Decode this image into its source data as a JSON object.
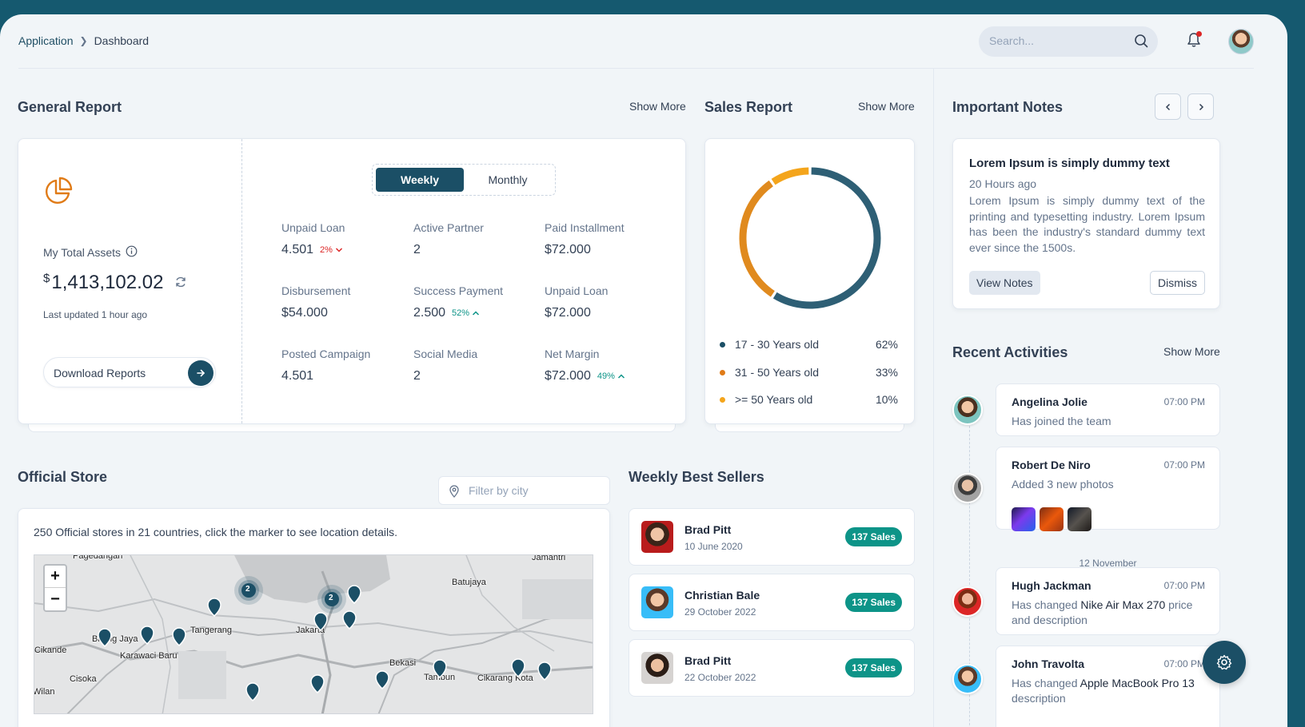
{
  "header": {
    "breadcrumb": [
      "Application",
      "Dashboard"
    ],
    "search_placeholder": "Search...",
    "icons": [
      "search-icon",
      "bell-icon",
      "avatar"
    ]
  },
  "general_report": {
    "title": "General Report",
    "show_more": "Show More",
    "assets_label": "My Total Assets",
    "currency": "$",
    "assets_value": "1,413,102.02",
    "updated": "Last updated 1 hour ago",
    "download_label": "Download Reports",
    "tabs": [
      "Weekly",
      "Monthly"
    ],
    "active_tab": "Weekly",
    "stats": [
      {
        "label": "Unpaid Loan",
        "value": "4.501",
        "change": "2%",
        "trend": "down"
      },
      {
        "label": "Active Partner",
        "value": "2",
        "change": "",
        "trend": ""
      },
      {
        "label": "Paid Installment",
        "value": "$72.000",
        "change": "",
        "trend": ""
      },
      {
        "label": "Disbursement",
        "value": "$54.000",
        "change": "",
        "trend": ""
      },
      {
        "label": "Success Payment",
        "value": "2.500",
        "change": "52%",
        "trend": "up"
      },
      {
        "label": "Unpaid Loan",
        "value": "$72.000",
        "change": "",
        "trend": ""
      },
      {
        "label": "Posted Campaign",
        "value": "4.501",
        "change": "",
        "trend": ""
      },
      {
        "label": "Social Media",
        "value": "2",
        "change": "",
        "trend": ""
      },
      {
        "label": "Net Margin",
        "value": "$72.000",
        "change": "49%",
        "trend": "up"
      }
    ]
  },
  "sales_report": {
    "title": "Sales Report",
    "show_more": "Show More",
    "colors": [
      "#2e5f75",
      "#e08a1e",
      "#f4a51c"
    ],
    "legend": [
      {
        "label": "17 - 30 Years old",
        "pct": "62%",
        "value": 62
      },
      {
        "label": "31 - 50 Years old",
        "pct": "33%",
        "value": 33
      },
      {
        "label": ">= 50 Years old",
        "pct": "10%",
        "value": 10
      }
    ]
  },
  "notes": {
    "title": "Important Notes",
    "note_title": "Lorem Ipsum is simply dummy text",
    "note_time": "20 Hours ago",
    "note_body": "Lorem Ipsum is simply dummy text of the printing and typesetting industry. Lorem Ipsum has been the industry's standard dummy text ever since the 1500s.",
    "view_label": "View Notes",
    "dismiss_label": "Dismiss"
  },
  "activities": {
    "title": "Recent Activities",
    "show_more": "Show More",
    "date_separator": "12 November",
    "items": [
      {
        "name": "Angelina Jolie",
        "time": "07:00 PM",
        "text": "Has joined the team"
      },
      {
        "name": "Robert De Niro",
        "time": "07:00 PM",
        "text": "Added 3 new photos"
      },
      {
        "name": "Hugh Jackman",
        "time": "07:00 PM",
        "pre": "Has changed ",
        "highlight": "Nike Air Max 270",
        "post": " price and description"
      },
      {
        "name": "John Travolta",
        "time": "07:00 PM",
        "pre": "Has changed ",
        "highlight": "Apple MacBook Pro 13",
        "post": " description"
      }
    ]
  },
  "store": {
    "title": "Official Store",
    "filter_placeholder": "Filter by city",
    "description": "250 Official stores in 21 countries, click the marker to see location details.",
    "zoom_in": "+",
    "zoom_out": "−",
    "cluster_counts": [
      "2",
      "2"
    ],
    "map_labels": [
      "Pagedangan",
      "Jamantri",
      "Batujaya",
      "Tangerang",
      "Jakarta",
      "Bekasi",
      "Tambun",
      "Cikarang Kota",
      "Cikande",
      "Karawaci Baru",
      "Cisoka",
      "Bitung Jaya",
      "Wilan"
    ]
  },
  "best_sellers": {
    "title": "Weekly Best Sellers",
    "items": [
      {
        "name": "Brad Pitt",
        "date": "10 June 2020",
        "badge": "137 Sales"
      },
      {
        "name": "Christian Bale",
        "date": "29 October 2022",
        "badge": "137 Sales"
      },
      {
        "name": "Brad Pitt",
        "date": "22 October 2022",
        "badge": "137 Sales"
      }
    ]
  }
}
